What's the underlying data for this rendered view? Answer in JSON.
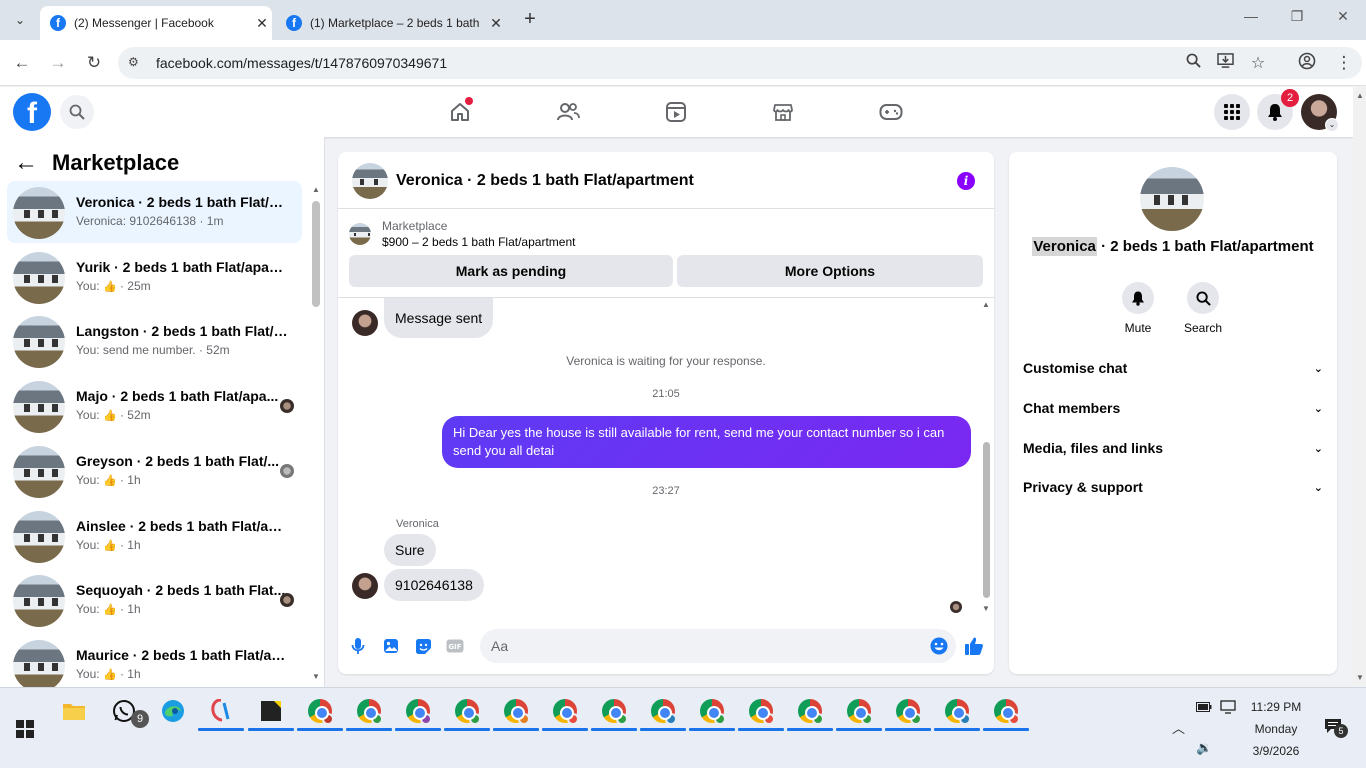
{
  "browser": {
    "tabs": [
      {
        "title": "(2) Messenger | Facebook",
        "active": true
      },
      {
        "title": "(1) Marketplace – 2 beds 1 bath",
        "active": false
      }
    ],
    "url": "facebook.com/messages/t/1478760970349671"
  },
  "header": {
    "notifications_count": "2",
    "accent_color": "#1877f2"
  },
  "left_panel": {
    "title": "Marketplace",
    "chats": [
      {
        "name": "Veronica · 2 beds 1 bath Flat/ap...",
        "preview": "Veronica: 9102646138 · 1m",
        "active": true,
        "like": false,
        "read_avatar": false
      },
      {
        "name": "Yurik · 2 beds 1 bath Flat/apart...",
        "preview_prefix": "You:",
        "preview_suffix": " · 25m",
        "like": true,
        "read_avatar": false
      },
      {
        "name": "Langston · 2 beds 1 bath Flat/a...",
        "preview": "You: send me number. · 52m",
        "like": false,
        "read_avatar": false
      },
      {
        "name": "Majo · 2 beds 1 bath Flat/apa...",
        "preview_prefix": "You:",
        "preview_suffix": " · 52m",
        "like": true,
        "read_avatar": true
      },
      {
        "name": "Greyson · 2 beds 1 bath Flat/...",
        "preview_prefix": "You:",
        "preview_suffix": " · 1h",
        "like": true,
        "read_avatar": true
      },
      {
        "name": "Ainslee · 2 beds 1 bath Flat/apa...",
        "preview_prefix": "You:",
        "preview_suffix": " · 1h",
        "like": true,
        "read_avatar": false
      },
      {
        "name": "Sequoyah · 2 beds 1 bath Flat...",
        "preview_prefix": "You:",
        "preview_suffix": " · 1h",
        "like": true,
        "read_avatar": true
      },
      {
        "name": "Maurice · 2 beds 1 bath Flat/ap...",
        "preview_prefix": "You:",
        "preview_suffix": " · 1h",
        "like": true,
        "read_avatar": false
      }
    ]
  },
  "chat": {
    "title": "Veronica · 2 beds 1 bath Flat/apartment",
    "marketplace_label": "Marketplace",
    "listing": "$900 – 2 beds 1 bath Flat/apartment",
    "mark_pending_label": "Mark as pending",
    "more_options_label": "More Options",
    "messages": {
      "first_in": "Message sent",
      "waiting": "Veronica is waiting for your response.",
      "time1": "21:05",
      "out_text": "Hi Dear yes the house is still available for rent, send me your contact number so i can send you all detai",
      "time2": "23:27",
      "sender": "Veronica",
      "in1": "Sure",
      "in2": "9102646138"
    },
    "composer_placeholder": "Aa",
    "brand_purple": "#7a28f2"
  },
  "right_panel": {
    "name_highlight": "Veronica",
    "name_rest": " · 2 beds 1 bath Flat/apartment",
    "mute_label": "Mute",
    "search_label": "Search",
    "sections": [
      "Customise chat",
      "Chat members",
      "Media, files and links",
      "Privacy & support"
    ]
  },
  "taskbar": {
    "whatsapp_badge": "9",
    "time": "11:29 PM",
    "day": "Monday",
    "date": "3/9/2026",
    "notification_count": "5",
    "chrome_profile_colors": [
      "#c0392b",
      "#2e9e44",
      "#8e44ad",
      "#2e9e44",
      "#e67e22",
      "#e74c3c",
      "#2e9e44",
      "#2980b9",
      "#2e9e44",
      "#e74c3c",
      "#2e9e44",
      "#2e9e44",
      "#2e9e44",
      "#2980b9",
      "#e74c3c"
    ]
  }
}
